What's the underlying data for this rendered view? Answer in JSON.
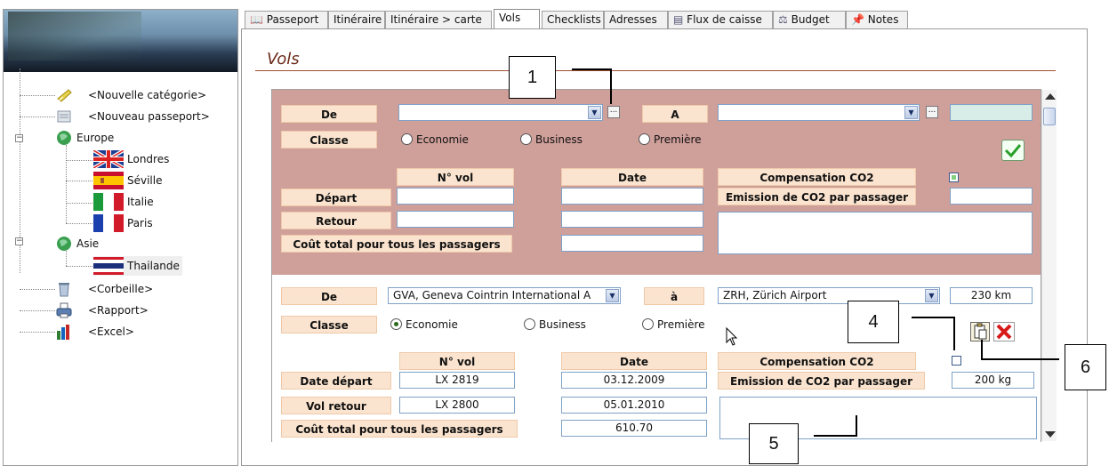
{
  "tree": {
    "items": [
      {
        "label": "<Nouvelle catégorie>",
        "icon": "folder-new-icon"
      },
      {
        "label": "<Nouveau passeport>",
        "icon": "passport-new-icon"
      },
      {
        "label": "Europe",
        "icon": "globe-icon"
      },
      {
        "label": "Londres",
        "icon": "uk-flag-icon"
      },
      {
        "label": "Séville",
        "icon": "spain-flag-icon"
      },
      {
        "label": "Italie",
        "icon": "italy-flag-icon"
      },
      {
        "label": "Paris",
        "icon": "france-flag-icon"
      },
      {
        "label": "Asie",
        "icon": "globe-icon"
      },
      {
        "label": "Thailande",
        "icon": "thailand-flag-icon"
      },
      {
        "label": "<Corbeille>",
        "icon": "trash-icon"
      },
      {
        "label": "<Rapport>",
        "icon": "printer-icon"
      },
      {
        "label": "<Excel>",
        "icon": "excel-chart-icon"
      }
    ],
    "expand_symbol": "−"
  },
  "tabs": [
    "Passeport",
    "Itinéraire",
    "Itinéraire > carte",
    "Vols",
    "Checklists",
    "Adresses",
    "Flux de caisse",
    "Budget",
    "Notes"
  ],
  "active_tab": "Vols",
  "page_title": "Vols",
  "form1": {
    "from_label": "De",
    "to_label": "A",
    "from_value": "",
    "to_value": "",
    "distance": "",
    "class_label": "Classe",
    "class_options": [
      "Economie",
      "Business",
      "Première"
    ],
    "flight_no_header": "N° vol",
    "date_header": "Date",
    "co2_header": "Compensation CO2",
    "co2_checked": true,
    "departure_label": "Départ",
    "return_label": "Retour",
    "total_cost_label": "Coût total pour tous les passagers",
    "co2_emission_label": "Emission de CO2 par passager",
    "departure_flight": "",
    "return_flight": "",
    "departure_date": "",
    "return_date": "",
    "total_cost": "",
    "co2_emission": "",
    "dots": "...",
    "dd": "▼"
  },
  "form2": {
    "from_label": "De",
    "to_label": "à",
    "from_value": "GVA, Geneva Cointrin International A",
    "to_value": "ZRH, Zürich Airport",
    "distance": "230 km",
    "class_label": "Classe",
    "class_options": [
      "Economie",
      "Business",
      "Première"
    ],
    "selected_class": "Economie",
    "flight_no_header": "N° vol",
    "date_header": "Date",
    "co2_header": "Compensation CO2",
    "co2_checked": false,
    "departure_label": "Date départ",
    "return_label": "Vol retour",
    "total_cost_label": "Coût total pour tous les passagers",
    "co2_emission_label": "Emission de CO2 par passager",
    "departure_flight": "LX 2819",
    "return_flight": "LX 2800",
    "departure_date": "03.12.2009",
    "return_date": "05.01.2010",
    "total_cost": "610.70",
    "co2_emission": "200 kg",
    "dd": "▼"
  },
  "callouts": [
    "1",
    "4",
    "5",
    "6"
  ],
  "colors": {
    "record_bg": "#cf9f9a",
    "label_bg": "#fbe4cf",
    "title": "#6b2a1a"
  }
}
